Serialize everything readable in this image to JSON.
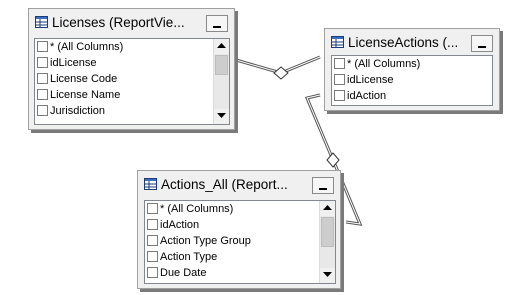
{
  "tables": {
    "licenses": {
      "title": "Licenses (ReportVie...",
      "columns": [
        "* (All Columns)",
        "idLicense",
        "License Code",
        "License Name",
        "Jurisdiction"
      ]
    },
    "license_actions": {
      "title": "LicenseActions (...",
      "columns": [
        "* (All Columns)",
        "idLicense",
        "idAction"
      ]
    },
    "actions_all": {
      "title": "Actions_All (Report...",
      "columns": [
        "* (All Columns)",
        "idAction",
        "Action Type Group",
        "Action Type",
        "Due Date"
      ]
    }
  }
}
